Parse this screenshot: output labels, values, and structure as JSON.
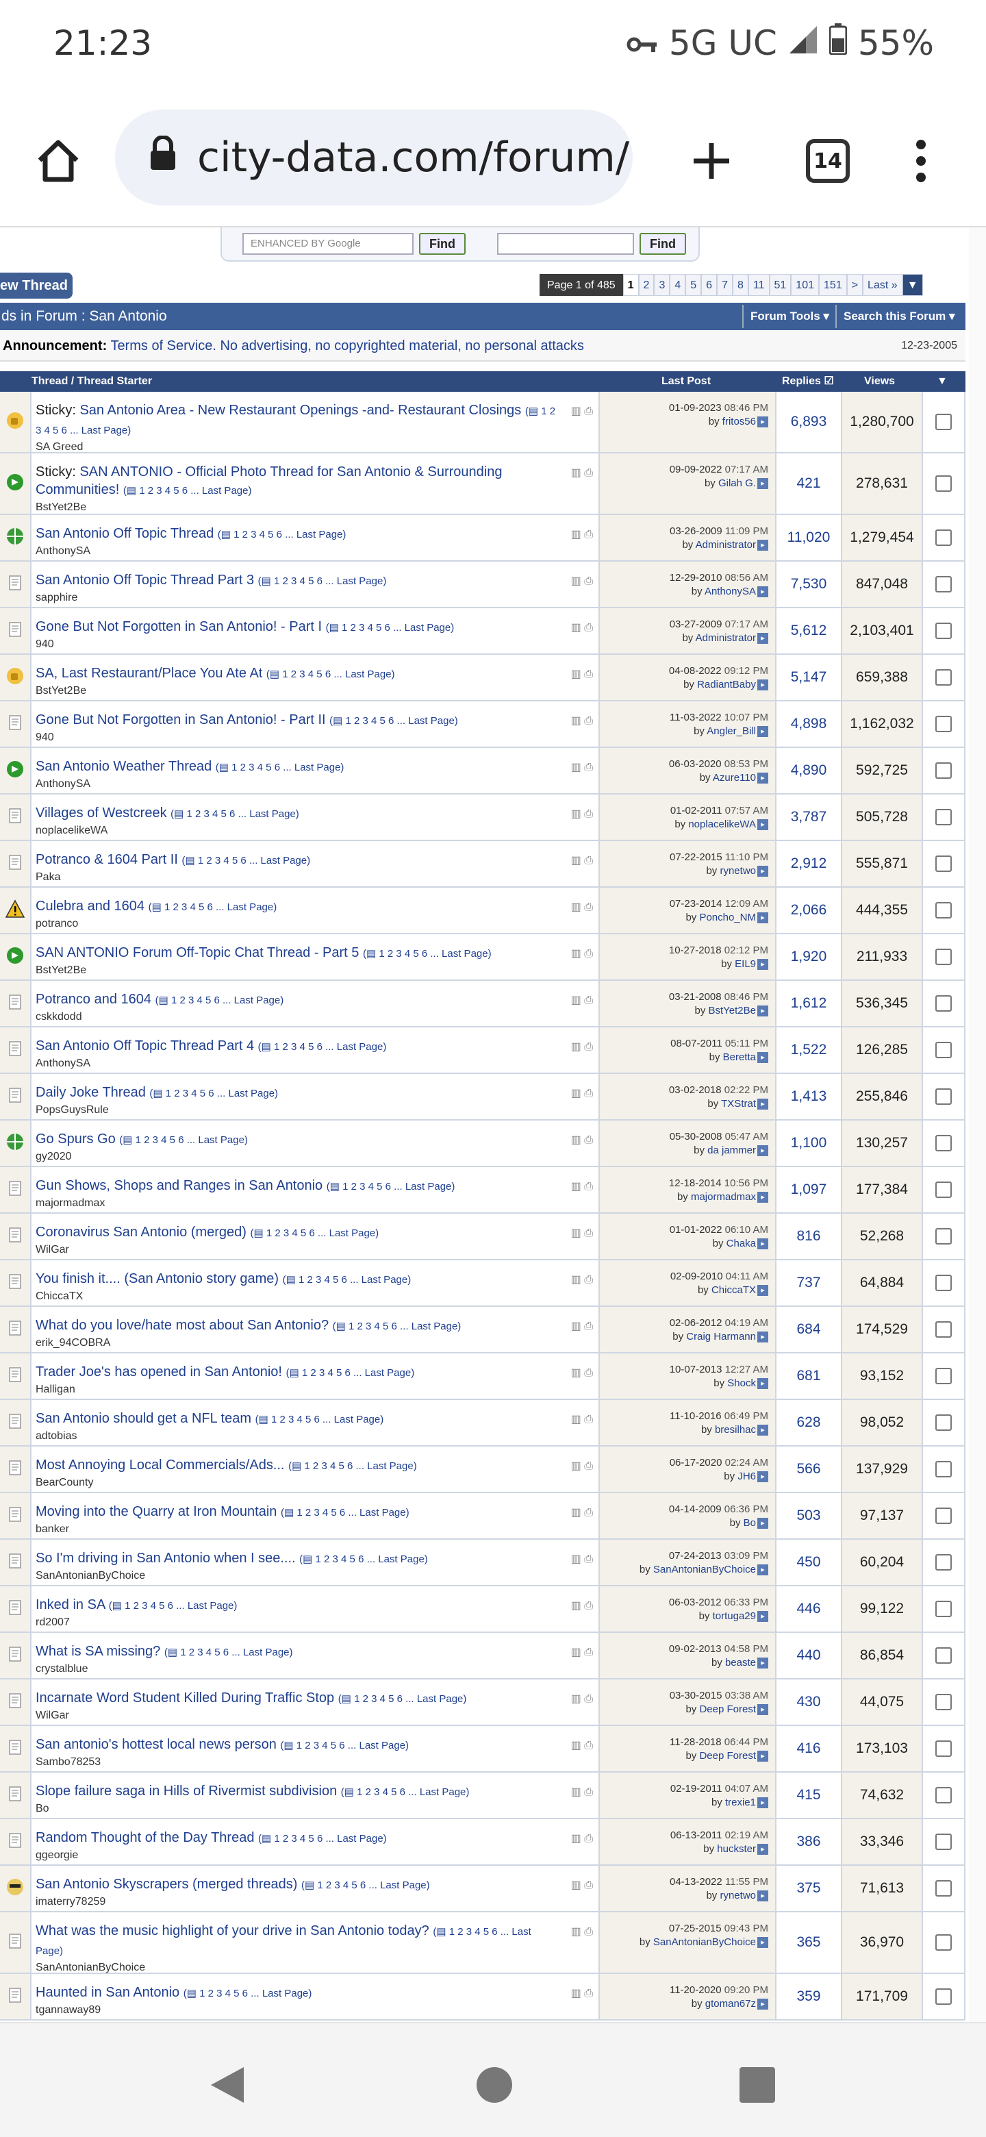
{
  "status_bar": {
    "time": "21:23",
    "network": "5G UC",
    "battery": "55%"
  },
  "browser": {
    "url": "city-data.com/forum/",
    "tab_count": "14"
  },
  "search": {
    "placeholder": "ENHANCED BY Google",
    "find_label": "Find",
    "find_label_2": "Find"
  },
  "new_thread_label": "ew Thread",
  "pager": {
    "label": "Page 1 of 485",
    "pages": [
      "1",
      "2",
      "3",
      "4",
      "5",
      "6",
      "7",
      "8",
      "11",
      "51",
      "101",
      "151",
      ">",
      "Last »"
    ]
  },
  "forum_bar": {
    "title": "ds in Forum",
    "forum_name": ": San Antonio",
    "tools": "Forum Tools",
    "search": "Search this Forum"
  },
  "announcement": {
    "label": "Announcement",
    "text": "Terms of Service. No advertising, no copyrighted material, no personal attacks",
    "date": "12-23-2005"
  },
  "table_headers": {
    "thread": "Thread / Thread Starter",
    "last_post": "Last Post",
    "replies": "Replies",
    "views": "Views"
  },
  "threads": [
    {
      "icon": "thumb",
      "sticky": "Sticky: ",
      "title": "San Antonio Area - New Restaurant Openings -and- Restaurant Closings",
      "pages": "1 2 3 4 5 6 ... Last Page",
      "starter": "SA Greed",
      "date": "01-09-2023",
      "time": "08:46 PM",
      "by": "fritos56",
      "replies": "6,893",
      "views": "1,280,700",
      "h": 90
    },
    {
      "icon": "arrow",
      "sticky": "Sticky: ",
      "title": "SAN ANTONIO - Official Photo Thread for San Antonio & Surrounding Communities!",
      "pages": "1 2 3 4 5 6 ... Last Page",
      "starter": "BstYet2Be",
      "date": "09-09-2022",
      "time": "07:17 AM",
      "by": "Gilah G.",
      "replies": "421",
      "views": "278,631",
      "h": 90
    },
    {
      "icon": "globe",
      "sticky": "",
      "title": "San Antonio Off Topic Thread",
      "pages": "1 2 3 4 5 6 ... Last Page",
      "starter": "AnthonySA",
      "date": "03-26-2009",
      "time": "11:09 PM",
      "by": "Administrator",
      "replies": "11,020",
      "views": "1,279,454",
      "h": 68
    },
    {
      "icon": "page",
      "sticky": "",
      "title": "San Antonio Off Topic Thread Part 3",
      "pages": "1 2 3 4 5 6 ... Last Page",
      "starter": "sapphire",
      "date": "12-29-2010",
      "time": "08:56 AM",
      "by": "AnthonySA",
      "replies": "7,530",
      "views": "847,048",
      "h": 68
    },
    {
      "icon": "page",
      "sticky": "",
      "title": "Gone But Not Forgotten in San Antonio! - Part I",
      "pages": "1 2 3 4 5 6 ... Last Page",
      "starter": "940",
      "date": "03-27-2009",
      "time": "07:17 AM",
      "by": "Administrator",
      "replies": "5,612",
      "views": "2,103,401",
      "h": 68
    },
    {
      "icon": "thumb",
      "sticky": "",
      "title": "SA, Last Restaurant/Place You Ate At",
      "pages": "1 2 3 4 5 6 ... Last Page",
      "starter": "BstYet2Be",
      "date": "04-08-2022",
      "time": "09:12 PM",
      "by": "RadiantBaby",
      "replies": "5,147",
      "views": "659,388",
      "h": 68
    },
    {
      "icon": "page",
      "sticky": "",
      "title": "Gone But Not Forgotten in San Antonio! - Part II",
      "pages": "1 2 3 4 5 6 ... Last Page",
      "starter": "940",
      "date": "11-03-2022",
      "time": "10:07 PM",
      "by": "Angler_Bill",
      "replies": "4,898",
      "views": "1,162,032",
      "h": 68
    },
    {
      "icon": "arrow",
      "sticky": "",
      "title": "San Antonio Weather Thread",
      "pages": "1 2 3 4 5 6 ... Last Page",
      "starter": "AnthonySA",
      "date": "06-03-2020",
      "time": "08:53 PM",
      "by": "Azure110",
      "replies": "4,890",
      "views": "592,725",
      "h": 68
    },
    {
      "icon": "page",
      "sticky": "",
      "title": "Villages of Westcreek",
      "pages": "1 2 3 4 5 6 ... Last Page",
      "starter": "noplacelikeWA",
      "date": "01-02-2011",
      "time": "07:57 AM",
      "by": "noplacelikeWA",
      "replies": "3,787",
      "views": "505,728",
      "h": 68
    },
    {
      "icon": "page",
      "sticky": "",
      "title": "Potranco & 1604 Part II",
      "pages": "1 2 3 4 5 6 ... Last Page",
      "starter": "Paka",
      "date": "07-22-2015",
      "time": "11:10 PM",
      "by": "rynetwo",
      "replies": "2,912",
      "views": "555,871",
      "h": 68
    },
    {
      "icon": "warn",
      "sticky": "",
      "title": "Culebra and 1604",
      "pages": "1 2 3 4 5 6 ... Last Page",
      "starter": "potranco",
      "date": "07-23-2014",
      "time": "12:09 AM",
      "by": "Poncho_NM",
      "replies": "2,066",
      "views": "444,355",
      "h": 68
    },
    {
      "icon": "arrow",
      "sticky": "",
      "title": "SAN ANTONIO Forum Off-Topic Chat Thread - Part 5",
      "pages": "1 2 3 4 5 6 ... Last Page",
      "starter": "BstYet2Be",
      "date": "10-27-2018",
      "time": "02:12 PM",
      "by": "EIL9",
      "replies": "1,920",
      "views": "211,933",
      "h": 68
    },
    {
      "icon": "page",
      "sticky": "",
      "title": "Potranco and 1604",
      "pages": "1 2 3 4 5 6 ... Last Page",
      "starter": "cskkdodd",
      "date": "03-21-2008",
      "time": "08:46 PM",
      "by": "BstYet2Be",
      "replies": "1,612",
      "views": "536,345",
      "h": 68
    },
    {
      "icon": "page",
      "sticky": "",
      "title": "San Antonio Off Topic Thread Part 4",
      "pages": "1 2 3 4 5 6 ... Last Page",
      "starter": "AnthonySA",
      "date": "08-07-2011",
      "time": "05:11 PM",
      "by": "Beretta",
      "replies": "1,522",
      "views": "126,285",
      "h": 68
    },
    {
      "icon": "page",
      "sticky": "",
      "title": "Daily Joke Thread",
      "pages": "1 2 3 4 5 6 ... Last Page",
      "starter": "PopsGuysRule",
      "date": "03-02-2018",
      "time": "02:22 PM",
      "by": "TXStrat",
      "replies": "1,413",
      "views": "255,846",
      "h": 68
    },
    {
      "icon": "globe",
      "sticky": "",
      "title": "Go Spurs Go",
      "pages": "1 2 3 4 5 6 ... Last Page",
      "starter": "gy2020",
      "date": "05-30-2008",
      "time": "05:47 AM",
      "by": "da jammer",
      "replies": "1,100",
      "views": "130,257",
      "h": 68
    },
    {
      "icon": "page",
      "sticky": "",
      "title": "Gun Shows, Shops and Ranges in San Antonio",
      "pages": "1 2 3 4 5 6 ... Last Page",
      "starter": "majormadmax",
      "date": "12-18-2014",
      "time": "10:56 PM",
      "by": "majormadmax",
      "replies": "1,097",
      "views": "177,384",
      "h": 68
    },
    {
      "icon": "page",
      "sticky": "",
      "title": "Coronavirus San Antonio (merged)",
      "pages": "1 2 3 4 5 6 ... Last Page",
      "starter": "WilGar",
      "date": "01-01-2022",
      "time": "06:10 AM",
      "by": "Chaka",
      "replies": "816",
      "views": "52,268",
      "h": 68
    },
    {
      "icon": "page",
      "sticky": "",
      "title": "You finish it.... (San Antonio story game)",
      "pages": "1 2 3 4 5 6 ... Last Page",
      "starter": "ChiccaTX",
      "date": "02-09-2010",
      "time": "04:11 AM",
      "by": "ChiccaTX",
      "replies": "737",
      "views": "64,884",
      "h": 68
    },
    {
      "icon": "page",
      "sticky": "",
      "title": "What do you love/hate most about San Antonio?",
      "pages": "1 2 3 4 5 6 ... Last Page",
      "starter": "erik_94COBRA",
      "date": "02-06-2012",
      "time": "04:19 AM",
      "by": "Craig Harmann",
      "replies": "684",
      "views": "174,529",
      "h": 68
    },
    {
      "icon": "page",
      "sticky": "",
      "title": "Trader Joe's has opened in San Antonio!",
      "pages": "1 2 3 4 5 6 ... Last Page",
      "starter": "Halligan",
      "date": "10-07-2013",
      "time": "12:27 AM",
      "by": "Shock",
      "replies": "681",
      "views": "93,152",
      "h": 68
    },
    {
      "icon": "page",
      "sticky": "",
      "title": "San Antonio should get a NFL team",
      "pages": "1 2 3 4 5 6 ... Last Page",
      "starter": "adtobias",
      "date": "11-10-2016",
      "time": "06:49 PM",
      "by": "bresilhac",
      "replies": "628",
      "views": "98,052",
      "h": 68
    },
    {
      "icon": "page",
      "sticky": "",
      "title": "Most Annoying Local Commercials/Ads...",
      "pages": "1 2 3 4 5 6 ... Last Page",
      "starter": "BearCounty",
      "date": "06-17-2020",
      "time": "02:24 AM",
      "by": "JH6",
      "replies": "566",
      "views": "137,929",
      "h": 68
    },
    {
      "icon": "page",
      "sticky": "",
      "title": "Moving into the Quarry at Iron Mountain",
      "pages": "1 2 3 4 5 6 ... Last Page",
      "starter": "banker",
      "date": "04-14-2009",
      "time": "06:36 PM",
      "by": "Bo",
      "replies": "503",
      "views": "97,137",
      "h": 68
    },
    {
      "icon": "page",
      "sticky": "",
      "title": "So I'm driving in San Antonio when I see....",
      "pages": "1 2 3 4 5 6 ... Last Page",
      "starter": "SanAntonianByChoice",
      "date": "07-24-2013",
      "time": "03:09 PM",
      "by": "SanAntonianByChoice",
      "replies": "450",
      "views": "60,204",
      "h": 68
    },
    {
      "icon": "page",
      "sticky": "",
      "title": "Inked in SA",
      "pages": "1 2 3 4 5 6 ... Last Page",
      "starter": "rd2007",
      "date": "06-03-2012",
      "time": "06:33 PM",
      "by": "tortuga29",
      "replies": "446",
      "views": "99,122",
      "h": 68
    },
    {
      "icon": "page",
      "sticky": "",
      "title": "What is SA missing?",
      "pages": "1 2 3 4 5 6 ... Last Page",
      "starter": "crystalblue",
      "date": "09-02-2013",
      "time": "04:58 PM",
      "by": "beaste",
      "replies": "440",
      "views": "86,854",
      "h": 68
    },
    {
      "icon": "page",
      "sticky": "",
      "title": "Incarnate Word Student Killed During Traffic Stop",
      "pages": "1 2 3 4 5 6 ... Last Page",
      "starter": "WilGar",
      "date": "03-30-2015",
      "time": "03:38 AM",
      "by": "Deep Forest",
      "replies": "430",
      "views": "44,075",
      "h": 68
    },
    {
      "icon": "page",
      "sticky": "",
      "title": "San antonio's hottest local news person",
      "pages": "1 2 3 4 5 6 ... Last Page",
      "starter": "Sambo78253",
      "date": "11-28-2018",
      "time": "06:44 PM",
      "by": "Deep Forest",
      "replies": "416",
      "views": "173,103",
      "h": 68
    },
    {
      "icon": "page",
      "sticky": "",
      "title": "Slope failure saga in Hills of Rivermist subdivision",
      "pages": "1 2 3 4 5 6 ... Last Page",
      "starter": "Bo",
      "date": "02-19-2011",
      "time": "04:07 AM",
      "by": "trexie1",
      "replies": "415",
      "views": "74,632",
      "h": 68
    },
    {
      "icon": "page",
      "sticky": "",
      "title": "Random Thought of the Day Thread",
      "pages": "1 2 3 4 5 6 ... Last Page",
      "starter": "ggeorgie",
      "date": "06-13-2011",
      "time": "02:19 AM",
      "by": "huckster",
      "replies": "386",
      "views": "33,346",
      "h": 68
    },
    {
      "icon": "smile",
      "sticky": "",
      "title": "San Antonio Skyscrapers (merged threads)",
      "pages": "1 2 3 4 5 6 ... Last Page",
      "starter": "imaterry78259",
      "date": "04-13-2022",
      "time": "11:55 PM",
      "by": "rynetwo",
      "replies": "375",
      "views": "71,613",
      "h": 68
    },
    {
      "icon": "page",
      "sticky": "",
      "title": "What was the music highlight of your drive in San Antonio today?",
      "pages": "1 2 3 4 5 6 ... Last Page",
      "starter": "SanAntonianByChoice",
      "date": "07-25-2015",
      "time": "09:43 PM",
      "by": "SanAntonianByChoice",
      "replies": "365",
      "views": "36,970",
      "h": 90
    },
    {
      "icon": "page",
      "sticky": "",
      "title": "Haunted in San Antonio",
      "pages": "1 2 3 4 5 6 ... Last Page",
      "starter": "tgannaway89",
      "date": "11-20-2020",
      "time": "09:20 PM",
      "by": "gtoman67z",
      "replies": "359",
      "views": "171,709",
      "h": 68
    }
  ],
  "last_post_by_prefix": "by ",
  "colors": {
    "header_blue": "#3d5f98",
    "link_blue": "#1f3f8f",
    "row_alt": "#f3f1e9"
  }
}
